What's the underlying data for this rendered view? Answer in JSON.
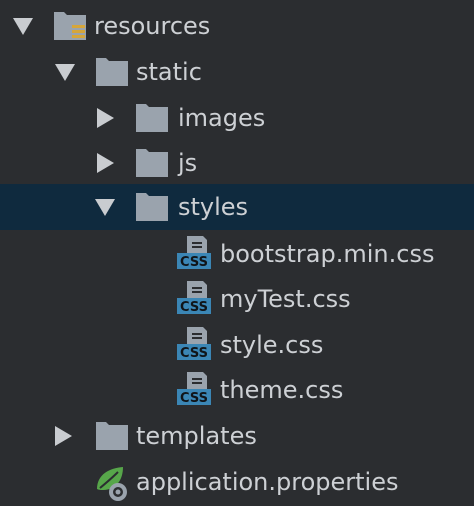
{
  "tree": {
    "items": [
      {
        "label": "resources",
        "kind": "resource-folder",
        "state": "expanded",
        "icon": "resources-folder-icon"
      },
      {
        "label": "static",
        "kind": "folder",
        "state": "expanded",
        "icon": "folder-icon"
      },
      {
        "label": "images",
        "kind": "folder",
        "state": "collapsed",
        "icon": "folder-icon"
      },
      {
        "label": "js",
        "kind": "folder",
        "state": "collapsed",
        "icon": "folder-icon"
      },
      {
        "label": "styles",
        "kind": "folder",
        "state": "expanded",
        "selected": true,
        "icon": "folder-icon"
      },
      {
        "label": "bootstrap.min.css",
        "kind": "file",
        "icon": "css-file-icon",
        "badge": "CSS"
      },
      {
        "label": "myTest.css",
        "kind": "file",
        "icon": "css-file-icon",
        "badge": "CSS"
      },
      {
        "label": "style.css",
        "kind": "file",
        "icon": "css-file-icon",
        "badge": "CSS"
      },
      {
        "label": "theme.css",
        "kind": "file",
        "icon": "css-file-icon",
        "badge": "CSS"
      },
      {
        "label": "templates",
        "kind": "folder",
        "state": "collapsed",
        "icon": "folder-icon"
      },
      {
        "label": "application.properties",
        "kind": "file",
        "icon": "spring-properties-icon"
      }
    ]
  },
  "colors": {
    "background": "#2b2d30",
    "selection": "#0f2a3e",
    "folder": "#9aa3ad",
    "arrow": "#c9ccd0",
    "css_badge": "#3b86b5",
    "spring_leaf": "#57a64a"
  }
}
